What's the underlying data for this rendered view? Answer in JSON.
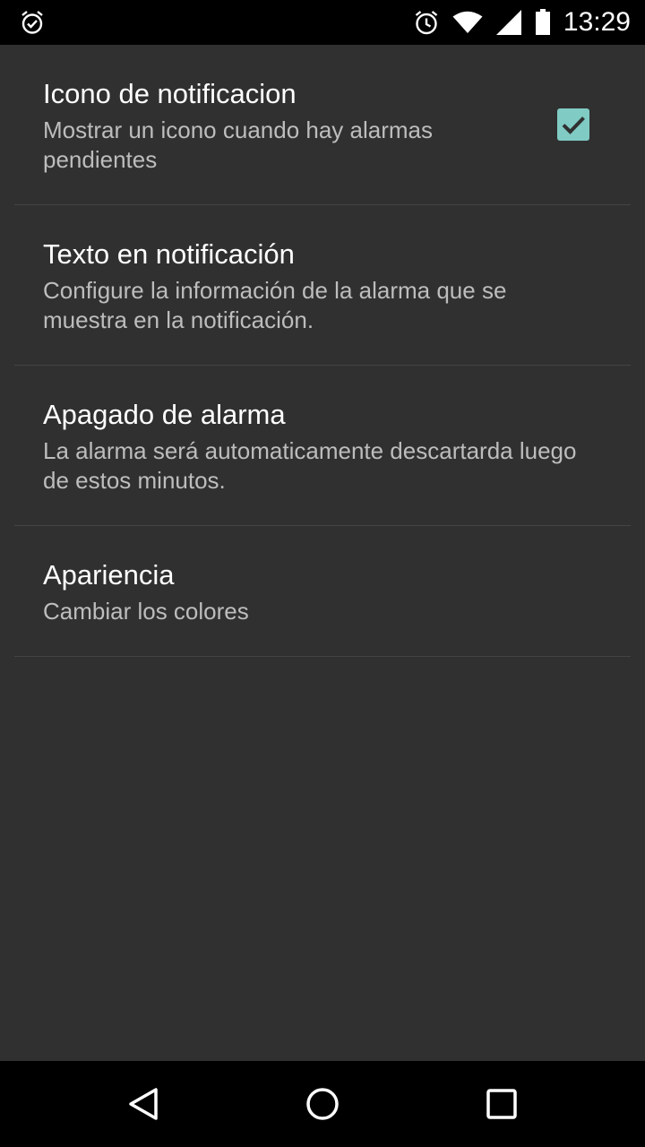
{
  "status_bar": {
    "time": "13:29",
    "icons": [
      "alarm-check-icon",
      "alarm-clock-icon",
      "wifi-icon",
      "signal-icon",
      "battery-icon"
    ]
  },
  "preferences": [
    {
      "title": "Icono de notificacion",
      "summary": "Mostrar un icono cuando hay alarmas pendientes",
      "checkbox": true
    },
    {
      "title": "Texto en notificación",
      "summary": "Configure la información de la alarma que se muestra en la notificación."
    },
    {
      "title": "Apagado de alarma",
      "summary": "La alarma será automaticamente descartarda luego de estos minutos."
    },
    {
      "title": "Apariencia",
      "summary": "Cambiar los colores"
    }
  ],
  "nav_bar": {
    "icons": [
      "back-icon",
      "home-icon",
      "recents-icon"
    ]
  },
  "colors": {
    "background": "#303030",
    "accent": "#80cbc4"
  }
}
